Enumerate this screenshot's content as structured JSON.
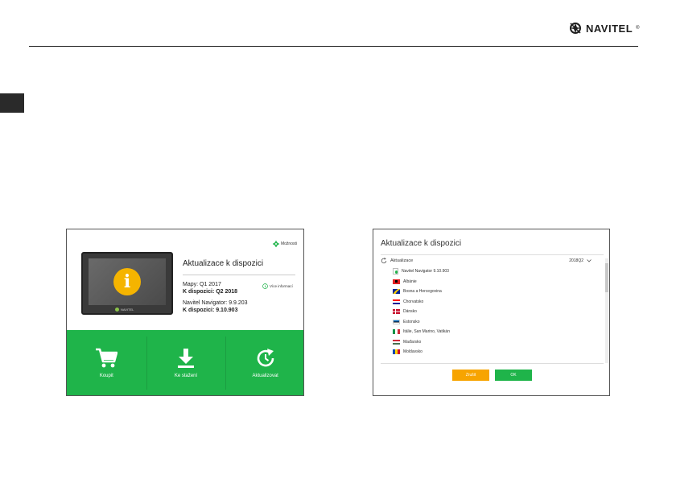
{
  "header": {
    "logo_text": "NAVITEL",
    "logo_reg": "®"
  },
  "left_panel": {
    "settings_label": "Možnosti",
    "title": "Aktualizace k dispozici",
    "maps_current": "Mapy: Q1 2017",
    "maps_available": "K dispozici: Q2 2018",
    "navigator_current": "Navitel Navigator: 9.9.203",
    "navigator_available": "K dispozici: 9.10.903",
    "more_info": "Více informací",
    "device_brand": "NAVITEL",
    "actions": [
      {
        "label": "Koupit",
        "icon": "cart-icon"
      },
      {
        "label": "Ke stažení",
        "icon": "download-icon"
      },
      {
        "label": "Aktualizovat",
        "icon": "refresh-icon"
      }
    ]
  },
  "right_panel": {
    "title": "Aktualizace k dispozici",
    "list_header": "Aktualizace",
    "version": "2018Q2",
    "items": [
      {
        "label": "Navitel Navigator 9.10.903",
        "icon": "navitel-app-icon"
      },
      {
        "label": "Albánie",
        "icon": "flag-albania"
      },
      {
        "label": "Bosna a Hercegovina",
        "icon": "flag-bosnia"
      },
      {
        "label": "Chorvatsko",
        "icon": "flag-croatia"
      },
      {
        "label": "Dánsko",
        "icon": "flag-denmark"
      },
      {
        "label": "Estonsko",
        "icon": "flag-estonia"
      },
      {
        "label": "Itálie, San Marino, Vatikán",
        "icon": "flag-italy"
      },
      {
        "label": "Maďarsko",
        "icon": "flag-hungary"
      },
      {
        "label": "Moldavsko",
        "icon": "flag-moldova"
      }
    ],
    "cancel_label": "Zrušit",
    "ok_label": "OK"
  },
  "colors": {
    "green": "#1fb44a",
    "orange": "#f7a400",
    "info_yellow": "#f5b400"
  }
}
